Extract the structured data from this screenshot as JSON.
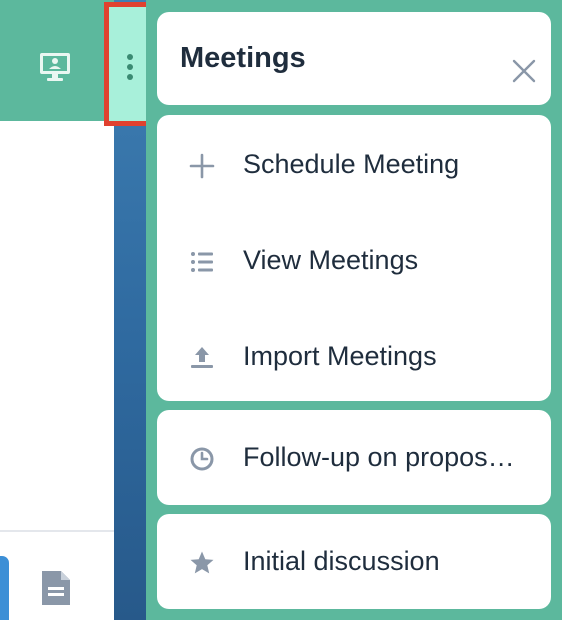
{
  "panel": {
    "title": "Meetings",
    "actions": [
      {
        "label": "Schedule Meeting",
        "icon": "plus-icon"
      },
      {
        "label": "View Meetings",
        "icon": "list-icon"
      },
      {
        "label": "Import Meetings",
        "icon": "upload-icon"
      }
    ],
    "recent": [
      {
        "label": "Follow-up on propos…",
        "icon": "clock-icon"
      },
      {
        "label": "Initial discussion",
        "icon": "star-icon"
      }
    ]
  },
  "colors": {
    "panel_bg": "#5cb89d",
    "highlight_border": "#e0412f",
    "kebab_bg": "#a8f0da",
    "text": "#1f2d3d",
    "icon": "#8a97a8"
  }
}
